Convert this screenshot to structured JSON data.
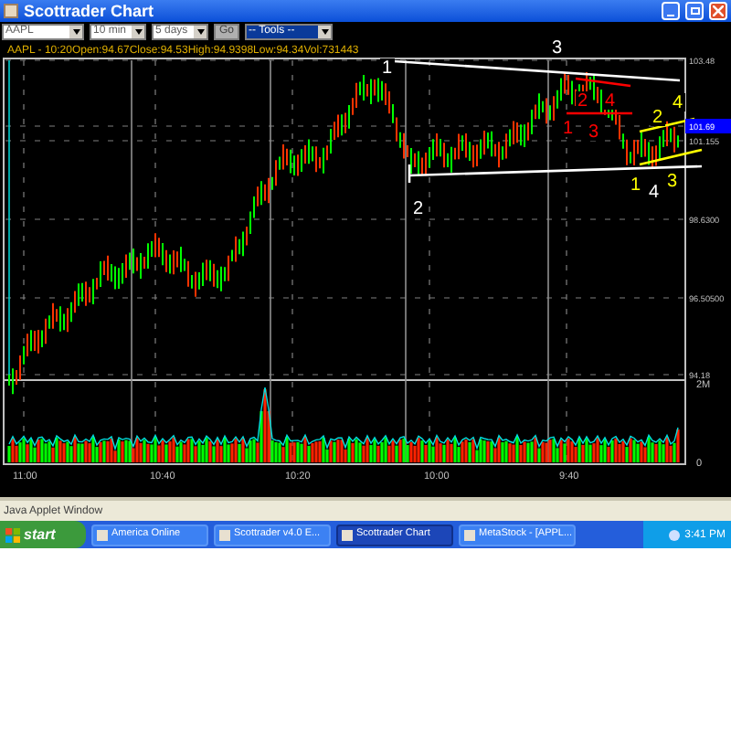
{
  "window": {
    "title": "Scottrader Chart"
  },
  "toolbar": {
    "fields": [
      {
        "kind": "dropdown",
        "value": "AAPL"
      },
      {
        "kind": "dropdown",
        "value": "10 min"
      },
      {
        "kind": "dropdown",
        "value": "5 days"
      },
      {
        "kind": "button",
        "value": "Go"
      },
      {
        "kind": "menu",
        "value": "-- Tools --"
      }
    ]
  },
  "chart": {
    "info": "AAPL - 10:20Open:94.67Close:94.53High:94.9398Low:94.34Vol:731443",
    "price_labels": [
      {
        "text": "103.48",
        "selected": false
      },
      {
        "text": "101.69",
        "selected": true
      },
      {
        "text": "101.155",
        "selected": false
      },
      {
        "text": "98.6300",
        "selected": false
      },
      {
        "text": "96.50500",
        "selected": false
      },
      {
        "text": "94.18",
        "selected": false
      }
    ],
    "volume_labels": [
      "2M",
      "0"
    ],
    "time_labels": [
      "11:00",
      "10:40",
      "10:20",
      "10:00",
      "9:40"
    ],
    "annotations": [
      {
        "text": "1",
        "color": "#ffffff"
      },
      {
        "text": "3",
        "color": "#ffffff"
      },
      {
        "text": "2",
        "color": "#ffffff"
      },
      {
        "text": "2",
        "color": "#ff0000"
      },
      {
        "text": "4",
        "color": "#ff0000"
      },
      {
        "text": "1",
        "color": "#ff0000"
      },
      {
        "text": "3",
        "color": "#ff0000"
      },
      {
        "text": "2",
        "color": "#ffff00"
      },
      {
        "text": "4",
        "color": "#ffff00"
      },
      {
        "text": "1",
        "color": "#ffff00"
      },
      {
        "text": "4",
        "color": "#ffffff"
      },
      {
        "text": "3",
        "color": "#ffff00"
      }
    ]
  },
  "status_bar": "Java Applet Window",
  "taskbar": {
    "start": "start",
    "tasks": [
      {
        "label": "America Online",
        "selected": false
      },
      {
        "label": "Scottrader v4.0 E...",
        "selected": false
      },
      {
        "label": "Scottrader Chart",
        "selected": true
      },
      {
        "label": "MetaStock - [APPL...",
        "selected": false
      }
    ],
    "clock": "3:41 PM"
  }
}
